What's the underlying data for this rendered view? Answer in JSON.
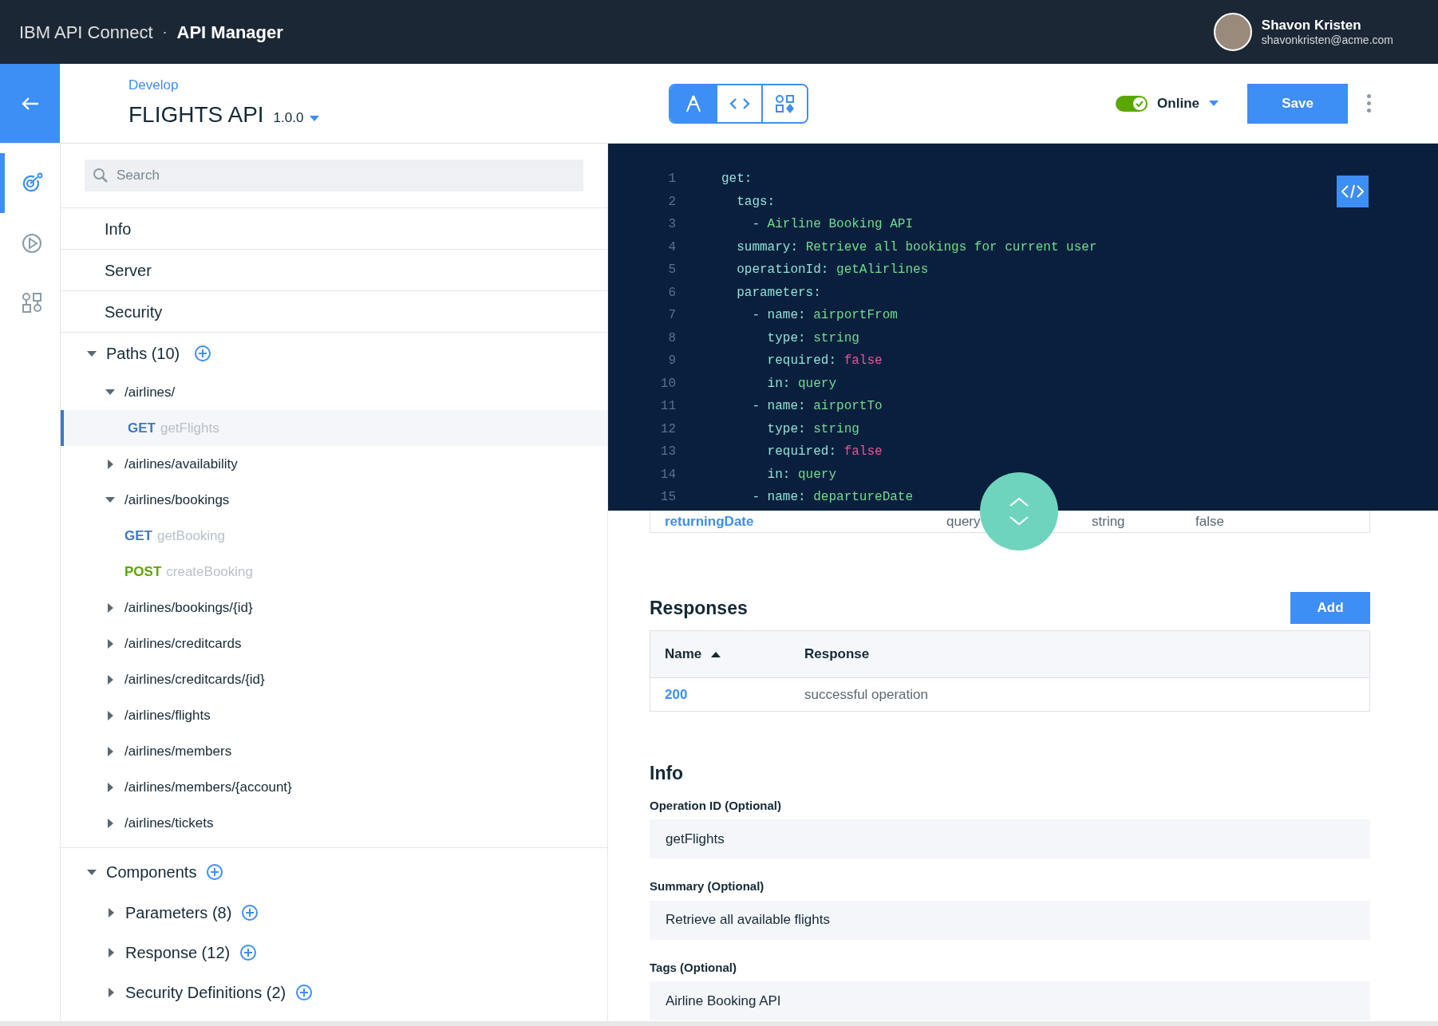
{
  "header": {
    "product": "IBM API Connect",
    "separator": "·",
    "app": "API Manager",
    "user": {
      "name": "Shavon Kristen",
      "email": "shavonkristen@acme.com"
    }
  },
  "subheader": {
    "breadcrumb": "Develop",
    "title": "FLIGHTS API",
    "version": "1.0.0",
    "modes": [
      {
        "kind": "design",
        "selected": true
      },
      {
        "kind": "source",
        "selected": false
      },
      {
        "kind": "assemble",
        "selected": false
      }
    ],
    "online": {
      "label": "Online",
      "on": true
    },
    "save": "Save"
  },
  "rail": [
    {
      "kind": "develop",
      "selected": true
    },
    {
      "kind": "test",
      "selected": false
    },
    {
      "kind": "assemble",
      "selected": false
    }
  ],
  "tree": {
    "search": {
      "placeholder": "Search"
    },
    "sections": [
      "Info",
      "Server",
      "Security"
    ],
    "paths": {
      "label": "Paths (10)",
      "expanded": true,
      "items": [
        {
          "label": "/airlines/",
          "expanded": true,
          "operations": [
            {
              "method": "GET",
              "name": "getFlights",
              "selected": true
            }
          ]
        },
        {
          "label": "/airlines/availability",
          "expanded": false
        },
        {
          "label": "/airlines/bookings",
          "expanded": true,
          "operations": [
            {
              "method": "GET",
              "name": "getBooking",
              "selected": false
            },
            {
              "method": "POST",
              "name": "createBooking",
              "selected": false
            }
          ]
        },
        {
          "label": "/airlines/bookings/{id}",
          "expanded": false
        },
        {
          "label": "/airlines/creditcards",
          "expanded": false
        },
        {
          "label": "/airlines/creditcards/{id}",
          "expanded": false
        },
        {
          "label": "/airlines/flights",
          "expanded": false
        },
        {
          "label": "/airlines/members",
          "expanded": false
        },
        {
          "label": "/airlines/members/{account}",
          "expanded": false
        },
        {
          "label": "/airlines/tickets",
          "expanded": false
        }
      ]
    },
    "components": {
      "label": "Components",
      "expanded": true,
      "items": [
        {
          "label": "Parameters (8)",
          "expanded": false
        },
        {
          "label": "Response (12)",
          "expanded": false
        },
        {
          "label": "Security Definitions (2)",
          "expanded": false
        }
      ]
    }
  },
  "code": {
    "lines": [
      {
        "num": "1",
        "parts": [
          {
            "text": "get:",
            "kind": "key"
          }
        ]
      },
      {
        "num": "2",
        "parts": [
          {
            "text": "  tags:",
            "kind": "key"
          }
        ]
      },
      {
        "num": "3",
        "parts": [
          {
            "text": "    - ",
            "kind": "key"
          },
          {
            "text": "Airline Booking API",
            "kind": "string"
          }
        ]
      },
      {
        "num": "4",
        "parts": [
          {
            "text": "  summary: ",
            "kind": "key"
          },
          {
            "text": "Retrieve all bookings for current user",
            "kind": "string"
          }
        ]
      },
      {
        "num": "5",
        "parts": [
          {
            "text": "  operationId: ",
            "kind": "key"
          },
          {
            "text": "getAlirlines",
            "kind": "string"
          }
        ]
      },
      {
        "num": "6",
        "parts": [
          {
            "text": "  parameters:",
            "kind": "key"
          }
        ]
      },
      {
        "num": "7",
        "parts": [
          {
            "text": "    - name: ",
            "kind": "key"
          },
          {
            "text": "airportFrom",
            "kind": "string"
          }
        ]
      },
      {
        "num": "8",
        "parts": [
          {
            "text": "      type: ",
            "kind": "key"
          },
          {
            "text": "string",
            "kind": "string"
          }
        ]
      },
      {
        "num": "9",
        "parts": [
          {
            "text": "      required: ",
            "kind": "key"
          },
          {
            "text": "false",
            "kind": "boolean"
          }
        ]
      },
      {
        "num": "10",
        "parts": [
          {
            "text": "      in: ",
            "kind": "key"
          },
          {
            "text": "query",
            "kind": "string"
          }
        ]
      },
      {
        "num": "11",
        "parts": [
          {
            "text": "    - name: ",
            "kind": "key"
          },
          {
            "text": "airportTo",
            "kind": "string"
          }
        ]
      },
      {
        "num": "12",
        "parts": [
          {
            "text": "      type: ",
            "kind": "key"
          },
          {
            "text": "string",
            "kind": "string"
          }
        ]
      },
      {
        "num": "13",
        "parts": [
          {
            "text": "      required: ",
            "kind": "key"
          },
          {
            "text": "false",
            "kind": "boolean"
          }
        ]
      },
      {
        "num": "14",
        "parts": [
          {
            "text": "      in: ",
            "kind": "key"
          },
          {
            "text": "query",
            "kind": "string"
          }
        ]
      },
      {
        "num": "15",
        "parts": [
          {
            "text": "    - name: ",
            "kind": "key"
          },
          {
            "text": "departureDate",
            "kind": "string"
          }
        ]
      }
    ]
  },
  "parameters_row": {
    "name": "returningDate",
    "in": "query",
    "type": "string",
    "required": "false"
  },
  "responses": {
    "title": "Responses",
    "add": "Add",
    "columns": [
      {
        "label": "Name",
        "sorted": true
      },
      {
        "label": "Response",
        "sorted": false
      }
    ],
    "rows": [
      {
        "code": "200",
        "response": "successful operation"
      }
    ]
  },
  "info": {
    "title": "Info",
    "fields": [
      {
        "label": "Operation ID (Optional)",
        "value": "getFlights"
      },
      {
        "label": "Summary (Optional)",
        "value": "Retrieve all available flights"
      },
      {
        "label": "Tags (Optional)",
        "value": "Airline Booking API"
      }
    ]
  }
}
